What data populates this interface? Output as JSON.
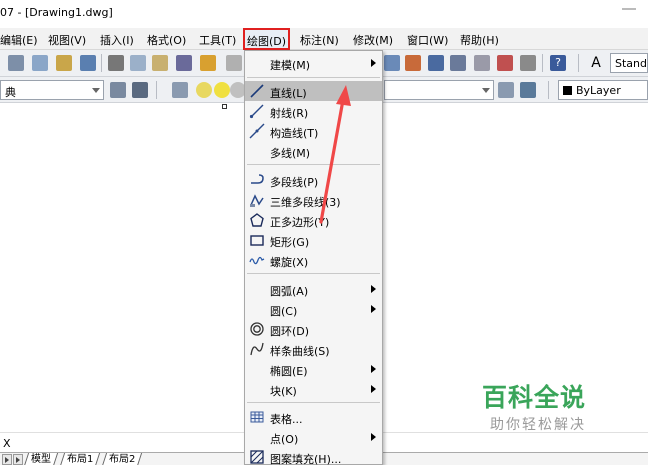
{
  "window": {
    "title": "07 - [Drawing1.dwg]"
  },
  "menubar": {
    "items": [
      {
        "label": "编辑(E)"
      },
      {
        "label": "视图(V)"
      },
      {
        "label": "插入(I)"
      },
      {
        "label": "格式(O)"
      },
      {
        "label": "工具(T)"
      },
      {
        "label": "绘图(D)"
      },
      {
        "label": "标注(N)"
      },
      {
        "label": "修改(M)"
      },
      {
        "label": "窗口(W)"
      },
      {
        "label": "帮助(H)"
      }
    ]
  },
  "toolbar": {
    "text_style_value": "Standa",
    "layer_value": "典",
    "linetype_value": "ByLayer"
  },
  "draw_menu": {
    "items": [
      {
        "label": "建模(M)",
        "icon": "none",
        "submenu": true
      },
      {
        "label": "直线(L)",
        "icon": "line-icon",
        "highlighted": true
      },
      {
        "label": "射线(R)",
        "icon": "ray-icon"
      },
      {
        "label": "构造线(T)",
        "icon": "construction-line-icon"
      },
      {
        "label": "多线(M)",
        "icon": "none"
      },
      {
        "label": "多段线(P)",
        "icon": "polyline-icon"
      },
      {
        "label": "三维多段线(3)",
        "icon": "3d-polyline-icon"
      },
      {
        "label": "正多边形(Y)",
        "icon": "polygon-icon"
      },
      {
        "label": "矩形(G)",
        "icon": "rectangle-icon"
      },
      {
        "label": "螺旋(X)",
        "icon": "helix-icon"
      },
      {
        "label": "圆弧(A)",
        "icon": "none",
        "submenu": true
      },
      {
        "label": "圆(C)",
        "icon": "none",
        "submenu": true
      },
      {
        "label": "圆环(D)",
        "icon": "donut-icon"
      },
      {
        "label": "样条曲线(S)",
        "icon": "spline-icon"
      },
      {
        "label": "椭圆(E)",
        "icon": "none",
        "submenu": true
      },
      {
        "label": "块(K)",
        "icon": "none",
        "submenu": true
      },
      {
        "label": "表格...",
        "icon": "table-icon"
      },
      {
        "label": "点(O)",
        "icon": "none",
        "submenu": true
      },
      {
        "label": "图案填充(H)...",
        "icon": "hatch-icon"
      }
    ]
  },
  "command_line": {
    "prompt": "X"
  },
  "layout_tabs": [
    {
      "label": "模型"
    },
    {
      "label": "布局1"
    },
    {
      "label": "布局2"
    }
  ],
  "watermark": {
    "title": "百科全说",
    "subtitle": "助你轻松解决"
  },
  "colors": {
    "highlight_border": "#e02020",
    "arrow": "#f04848",
    "watermark_green": "#3aa55a"
  }
}
